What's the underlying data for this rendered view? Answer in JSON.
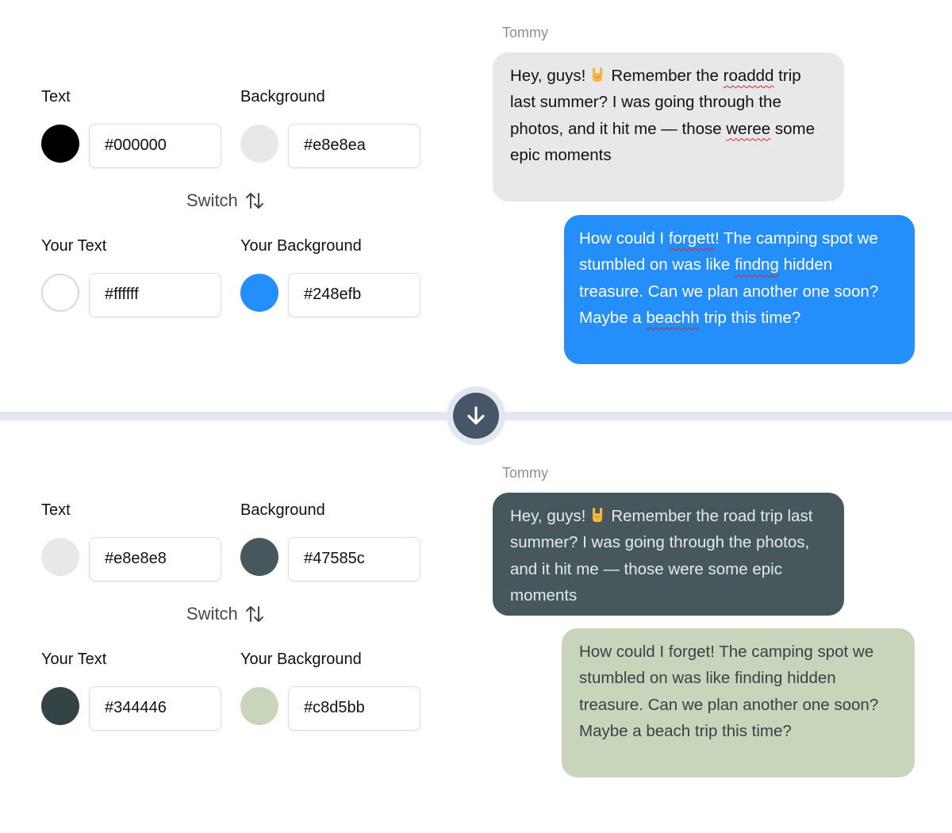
{
  "before": {
    "controls": {
      "text": {
        "label": "Text",
        "value": "#000000",
        "color": "#000000"
      },
      "background": {
        "label": "Background",
        "value": "#e8e8ea",
        "color": "#e8e8ea"
      },
      "switch_label": "Switch",
      "your_text": {
        "label": "Your Text",
        "value": "#ffffff",
        "color": "#ffffff"
      },
      "your_background": {
        "label": "Your Background",
        "value": "#248efb",
        "color": "#248efb"
      }
    },
    "chat": {
      "sender": "Tommy",
      "incoming": {
        "parts": [
          "Hey, guys!",
          "Remember the",
          "roaddd",
          "trip last summer? I was going through the photos, and it hit me — those",
          "weree",
          "some epic moments"
        ],
        "emoji": "sign-of-the-horns"
      },
      "outgoing": {
        "parts": [
          "How could I",
          "forgett",
          "! The camping spot we stumbled on was like",
          "findng",
          "hidden treasure. Can we plan another one soon? Maybe a",
          "beachh",
          "trip this time?"
        ]
      }
    }
  },
  "divider": {
    "icon": "arrow-down-icon"
  },
  "after": {
    "controls": {
      "text": {
        "label": "Text",
        "value": "#e8e8e8",
        "color": "#e8e8e8"
      },
      "background": {
        "label": "Background",
        "value": "#47585c",
        "color": "#47585c"
      },
      "switch_label": "Switch",
      "your_text": {
        "label": "Your Text",
        "value": "#344446",
        "color": "#344446"
      },
      "your_background": {
        "label": "Your Background",
        "value": "#c8d5bb",
        "color": "#c8d5bb"
      }
    },
    "chat": {
      "sender": "Tommy",
      "incoming": {
        "parts": [
          "Hey, guys!",
          "Remember the road trip last summer? I was going through the photos, and it hit me — those were some epic moments"
        ],
        "emoji": "sign-of-the-horns"
      },
      "outgoing": {
        "text": "How could I forget! The camping spot we stumbled on was like finding hidden treasure. Can we plan another one soon? Maybe a beach trip this time?"
      }
    }
  }
}
